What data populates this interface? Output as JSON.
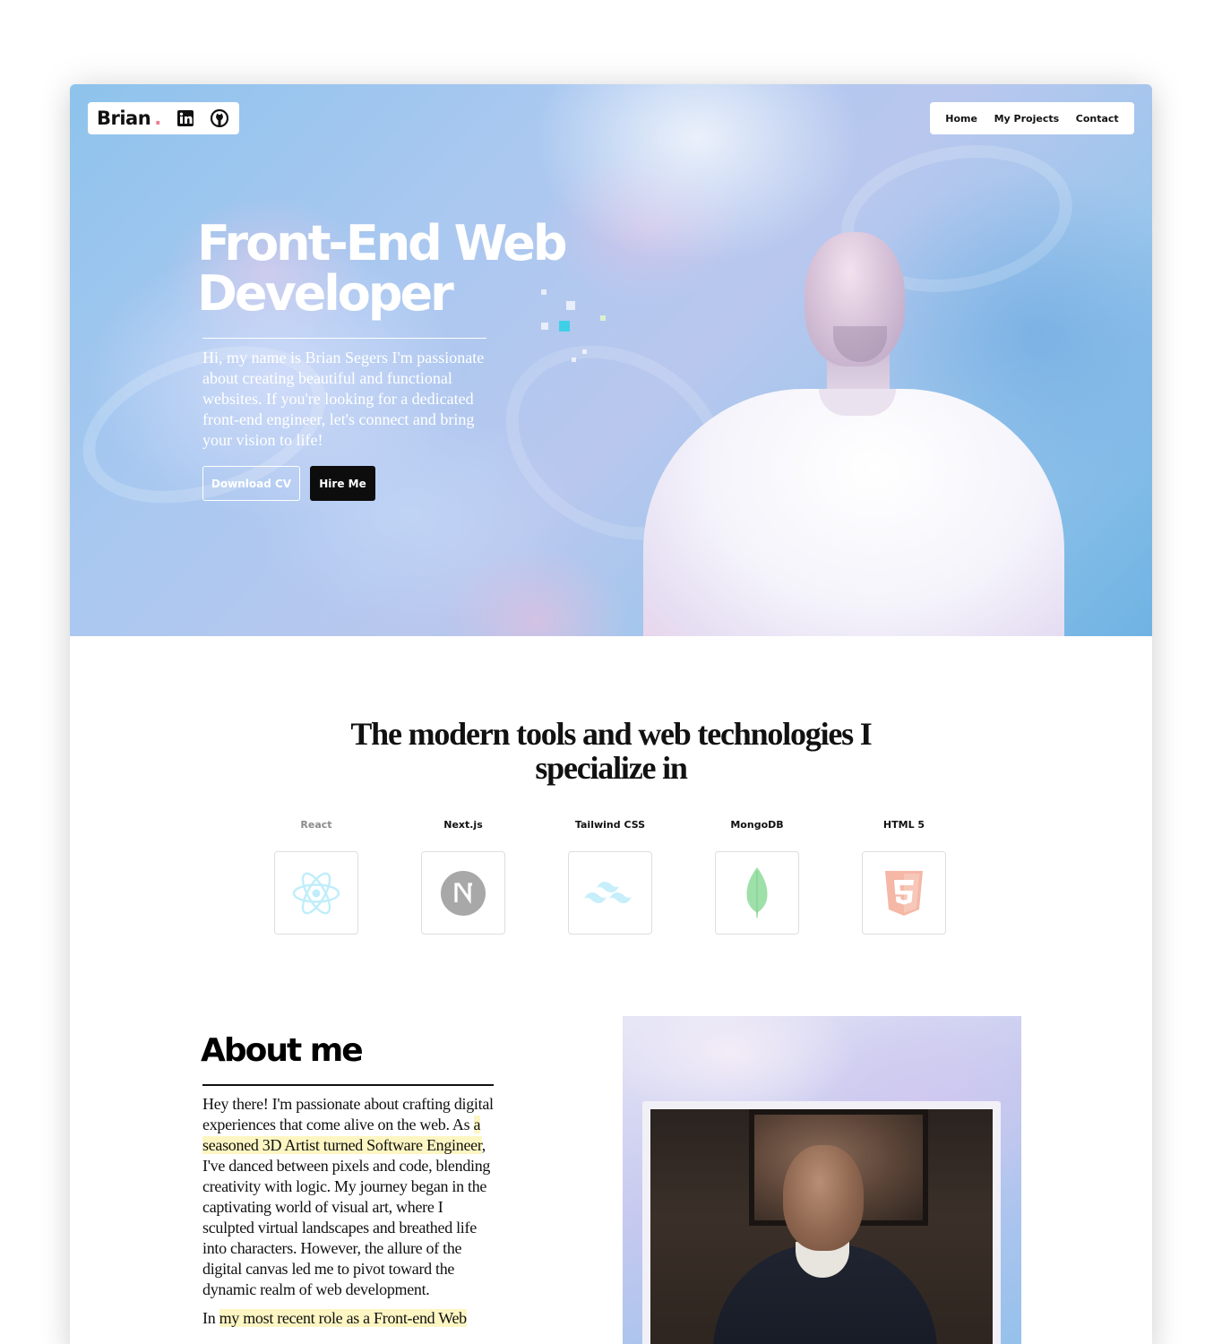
{
  "header": {
    "brand": "Brian",
    "brand_dot": ".",
    "social": [
      {
        "name": "linkedin-icon",
        "label": "in"
      },
      {
        "name": "github-icon",
        "label": ""
      }
    ],
    "nav": [
      "Home",
      "My Projects",
      "Contact"
    ]
  },
  "hero": {
    "title": "Front-End Web Developer",
    "text": "Hi, my name is Brian Segers I'm passionate about creating beautiful and functional websites. If you're looking for a dedicated front-end engineer, let's connect and bring your vision to life!",
    "buttons": {
      "download_cv": "Download CV",
      "hire_me": "Hire Me"
    }
  },
  "tech": {
    "heading": "The modern tools and web technologies I specialize in",
    "items": [
      {
        "label": "React",
        "icon": "react-icon",
        "color": "#61dafb"
      },
      {
        "label": "Next.js",
        "icon": "nextjs-icon",
        "color": "#000000"
      },
      {
        "label": "Tailwind CSS",
        "icon": "tailwind-icon",
        "color": "#38bdf8"
      },
      {
        "label": "MongoDB",
        "icon": "mongodb-icon",
        "color": "#47a248"
      },
      {
        "label": "HTML 5",
        "icon": "html5-icon",
        "color": "#e34f26"
      }
    ]
  },
  "about": {
    "title": "About me",
    "p1_a": "Hey there! I'm passionate about crafting digital experiences that come alive on the web. As ",
    "p1_hl": "a seasoned 3D Artist turned Software Engineer",
    "p1_b": ", I've danced between pixels and code, blending creativity with logic. My journey began in the captivating world of visual art, where I sculpted virtual landscapes and breathed life into characters. However, the allure of the digital canvas led me to pivot toward the dynamic realm of web development.",
    "p2_a": "In ",
    "p2_hl": "my most recent role as a Front-end Web"
  },
  "colors": {
    "accent_dot": "#f07b8f",
    "highlight": "#fdf6c3",
    "hire_button": "#0d0d0d"
  }
}
